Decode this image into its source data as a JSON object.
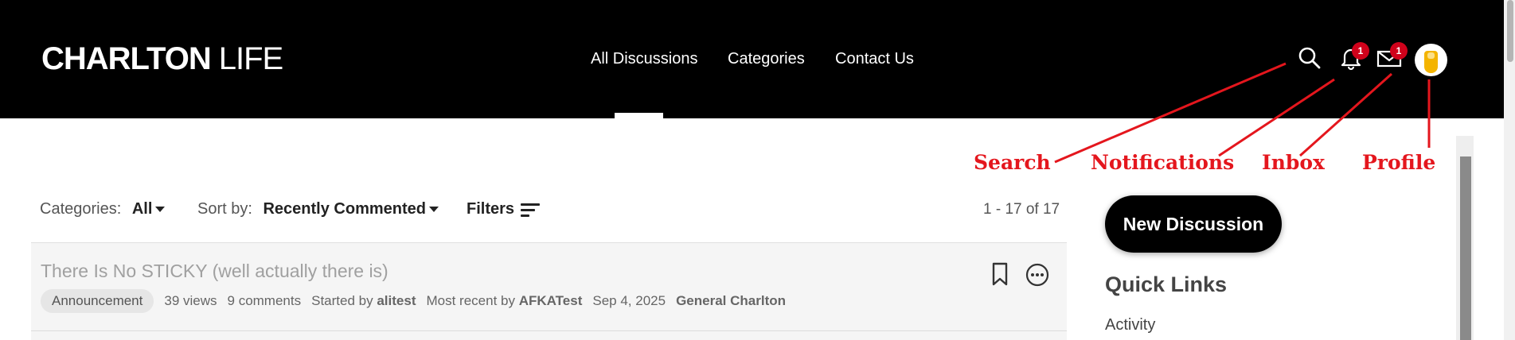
{
  "header": {
    "logo_bold": "CHARLTON",
    "logo_light": "LIFE",
    "nav": [
      {
        "label": "All Discussions",
        "active": true
      },
      {
        "label": "Categories",
        "active": false
      },
      {
        "label": "Contact Us",
        "active": false
      }
    ],
    "notifications_badge": "1",
    "inbox_badge": "1"
  },
  "annotations": {
    "search": "Search",
    "notifications": "Notifications",
    "inbox": "Inbox",
    "profile": "Profile",
    "color": "#e4161d"
  },
  "filters": {
    "categories_label": "Categories:",
    "categories_value": "All",
    "sort_label": "Sort by:",
    "sort_value": "Recently Commented",
    "filters_label": "Filters",
    "count": "1 - 17 of 17"
  },
  "discussions": [
    {
      "title": "There Is No STICKY (well actually there is)",
      "tag": "Announcement",
      "views": "39 views",
      "comments": "9 comments",
      "started_prefix": "Started by",
      "started_by": "alitest",
      "recent_prefix": "Most recent by",
      "recent_by": "AFKATest",
      "date": "Sep 4, 2025",
      "category": "General Charlton"
    }
  ],
  "sidebar": {
    "new_discussion": "New Discussion",
    "quick_links_title": "Quick Links",
    "quick_links": [
      "Activity"
    ]
  },
  "icons": [
    "search-icon",
    "bell-icon",
    "envelope-icon",
    "bookmark-icon",
    "more-options-icon",
    "filter-icon",
    "caret-down-icon"
  ]
}
